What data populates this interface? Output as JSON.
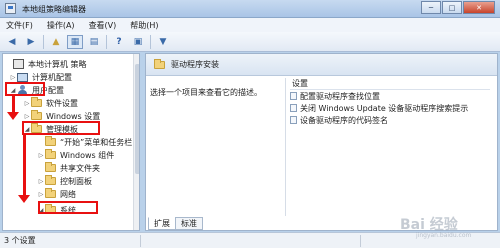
{
  "window": {
    "title": "本地组策略编辑器",
    "buttons": [
      "─",
      "□",
      "✕"
    ]
  },
  "menu": [
    "文件(F)",
    "操作(A)",
    "查看(V)",
    "帮助(H)"
  ],
  "toolbar": {
    "icons": [
      "back-icon",
      "forward-icon",
      "up-folder-icon",
      "show-tree-icon",
      "export-icon",
      "help-icon",
      "properties-icon",
      "filter-icon"
    ]
  },
  "tree": [
    {
      "label": "本地计算机 策略",
      "icon": "root-icon"
    },
    {
      "label": "计算机配置",
      "icon": "computer-icon"
    },
    {
      "label": "用户配置",
      "icon": "user-icon"
    },
    {
      "label": "软件设置",
      "icon": "folder-icon"
    },
    {
      "label": "Windows 设置",
      "icon": "folder-icon"
    },
    {
      "label": "管理模板",
      "icon": "folder-icon"
    },
    {
      "label": "“开始”菜单和任务栏",
      "icon": "folder-icon"
    },
    {
      "label": "Windows 组件",
      "icon": "folder-icon"
    },
    {
      "label": "共享文件夹",
      "icon": "folder-icon"
    },
    {
      "label": "控制面板",
      "icon": "folder-icon"
    },
    {
      "label": "网络",
      "icon": "folder-icon"
    },
    {
      "label": "系统",
      "icon": "folder-icon"
    }
  ],
  "right": {
    "header": "驱动程序安装",
    "description": "选择一个项目来查看它的描述。",
    "settings_header": "设置",
    "settings": [
      "配置驱动程序查找位置",
      "关闭 Windows Update 设备驱动程序搜索提示",
      "设备驱动程序的代码签名"
    ],
    "tabs": [
      "扩展",
      "标准"
    ]
  },
  "status": {
    "text": "3 个设置"
  },
  "watermark": {
    "main": "Bai 经验",
    "sub": "jingyan.baidu.com"
  },
  "colors": {
    "highlight": "#e81010",
    "titlebar": "#b9d1ea",
    "folder": "#f2d27a"
  }
}
